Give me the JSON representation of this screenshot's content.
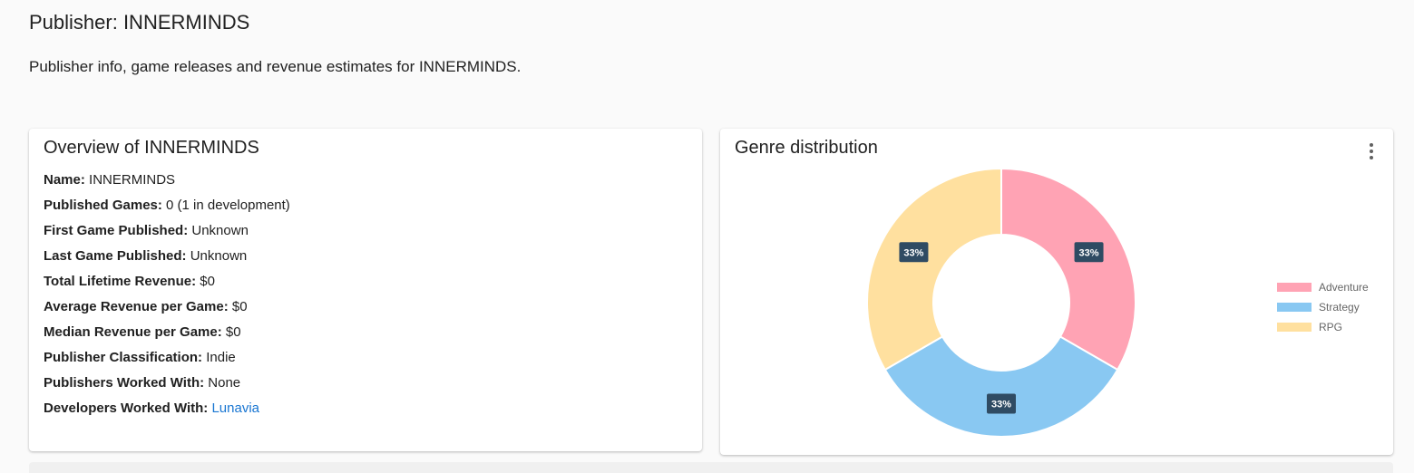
{
  "header": {
    "title": "Publisher: INNERMINDS",
    "subtitle": "Publisher info, game releases and revenue estimates for INNERMINDS."
  },
  "overview": {
    "title": "Overview of INNERMINDS",
    "rows": [
      {
        "label": "Name:",
        "value": "INNERMINDS"
      },
      {
        "label": "Published Games:",
        "value": "0 (1 in development)"
      },
      {
        "label": "First Game Published:",
        "value": "Unknown"
      },
      {
        "label": "Last Game Published:",
        "value": "Unknown"
      },
      {
        "label": "Total Lifetime Revenue:",
        "value": "$0"
      },
      {
        "label": "Average Revenue per Game:",
        "value": "$0"
      },
      {
        "label": "Median Revenue per Game:",
        "value": "$0"
      },
      {
        "label": "Publisher Classification:",
        "value": "Indie"
      },
      {
        "label": "Publishers Worked With:",
        "value": "None"
      },
      {
        "label": "Developers Worked With:",
        "value": "Lunavia"
      }
    ]
  },
  "genre_card": {
    "title": "Genre distribution",
    "menu_icon": "more-vert-icon"
  },
  "chart_data": {
    "type": "pie",
    "title": "Genre distribution",
    "donut": true,
    "legend_position": "right",
    "categories": [
      "Adventure",
      "Strategy",
      "RPG"
    ],
    "values": [
      33.33,
      33.33,
      33.33
    ],
    "data_labels": [
      "33%",
      "33%",
      "33%"
    ],
    "colors": [
      "#ffa3b4",
      "#89c8f2",
      "#ffe09f"
    ]
  }
}
